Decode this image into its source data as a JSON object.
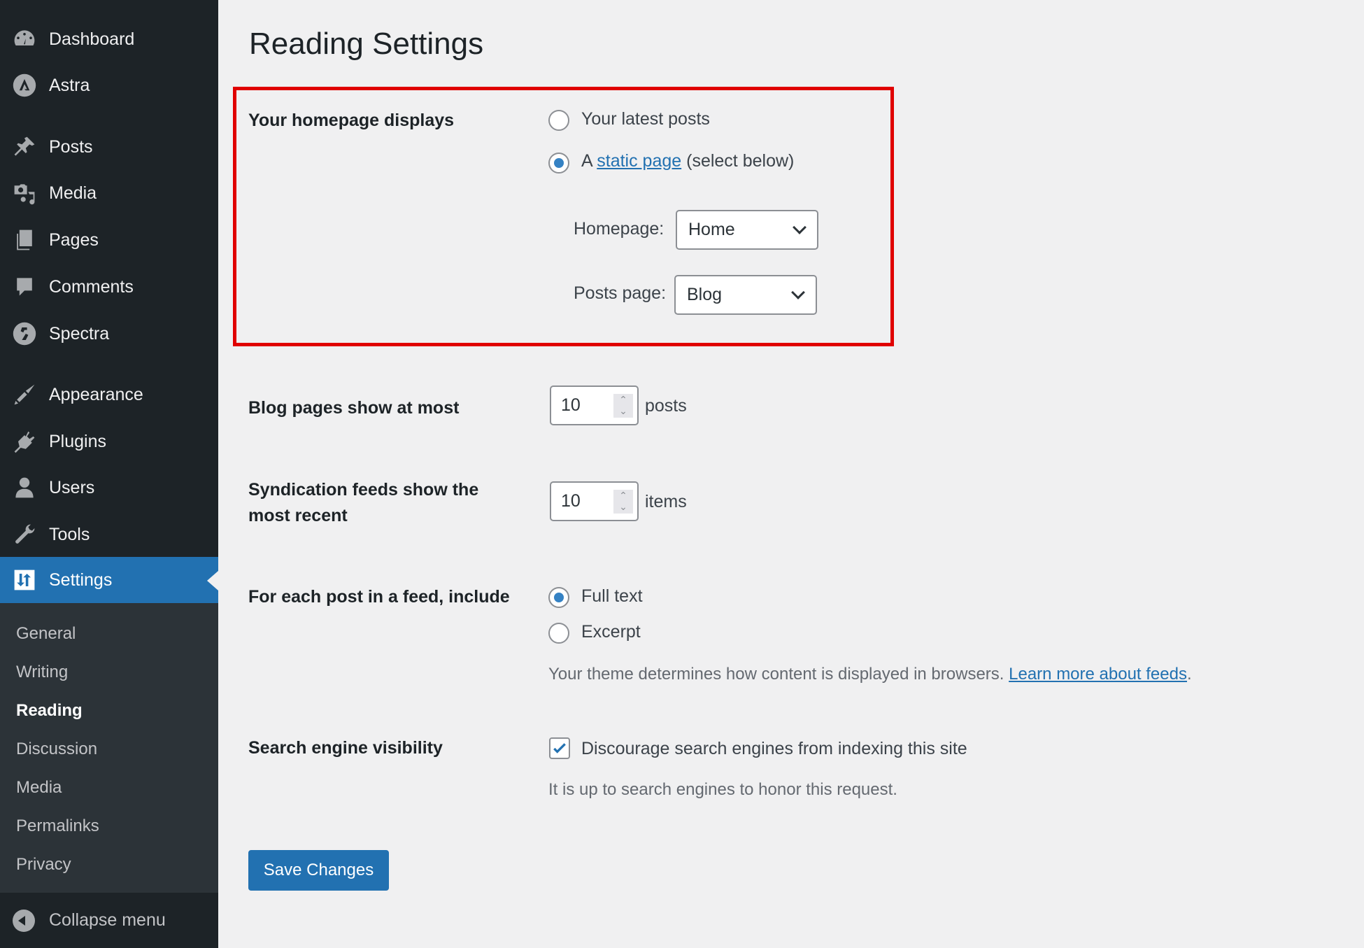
{
  "sidebar": {
    "menu": [
      {
        "label": "Dashboard",
        "icon": "dashboard-icon"
      },
      {
        "label": "Astra",
        "icon": "astra-icon"
      },
      {
        "label": "Posts",
        "icon": "pin-icon"
      },
      {
        "label": "Media",
        "icon": "media-icon"
      },
      {
        "label": "Pages",
        "icon": "pages-icon"
      },
      {
        "label": "Comments",
        "icon": "comment-icon"
      },
      {
        "label": "Spectra",
        "icon": "spectra-icon"
      },
      {
        "label": "Appearance",
        "icon": "paintbrush-icon"
      },
      {
        "label": "Plugins",
        "icon": "plug-icon"
      },
      {
        "label": "Users",
        "icon": "user-icon"
      },
      {
        "label": "Tools",
        "icon": "wrench-icon"
      },
      {
        "label": "Settings",
        "icon": "settings-icon",
        "active": true
      }
    ],
    "submenu": [
      "General",
      "Writing",
      "Reading",
      "Discussion",
      "Media",
      "Permalinks",
      "Privacy"
    ],
    "current_submenu": "Reading",
    "collapse_label": "Collapse menu"
  },
  "page": {
    "title": "Reading Settings",
    "homepage_displays": {
      "label": "Your homepage displays",
      "option_latest": "Your latest posts",
      "option_static_prefix": "A",
      "option_static_link": "static page",
      "option_static_suffix": "(select below)",
      "selected": "static",
      "homepage_label": "Homepage:",
      "homepage_value": "Home",
      "posts_page_label": "Posts page:",
      "posts_page_value": "Blog"
    },
    "blog_pages": {
      "label": "Blog pages show at most",
      "value": "10",
      "unit": "posts"
    },
    "syndication": {
      "label_line1": "Syndication feeds show the",
      "label_line2": "most recent",
      "value": "10",
      "unit": "items"
    },
    "feed_include": {
      "label": "For each post in a feed, include",
      "option_full": "Full text",
      "option_excerpt": "Excerpt",
      "selected": "full",
      "description": "Your theme determines how content is displayed in browsers.",
      "link": "Learn more about feeds",
      "link_suffix": "."
    },
    "search_visibility": {
      "label": "Search engine visibility",
      "checkbox_label": "Discourage search engines from indexing this site",
      "checked": true,
      "description": "It is up to search engines to honor this request."
    },
    "save_label": "Save Changes"
  },
  "colors": {
    "accent": "#2271b1",
    "sidebar": "#1d2327",
    "submenu": "#2c3338",
    "highlight": "#e00000",
    "background": "#f0f0f1"
  }
}
